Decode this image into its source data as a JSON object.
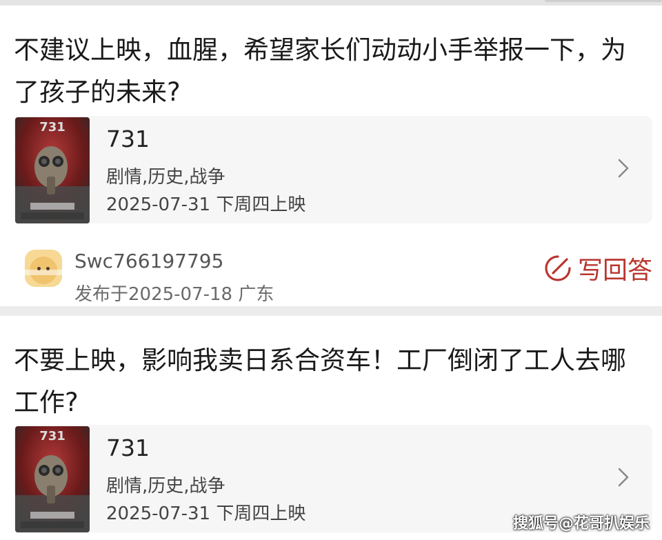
{
  "posts": [
    {
      "question": "不建议上映，血腥，希望家长们动动小手举报一下，为了孩子的未来?",
      "movie": {
        "title": "731",
        "genre": "剧情,历史,战争",
        "release": "2025-07-31 下周四上映",
        "poster_icon": "movie-poster-gasmask"
      },
      "author": {
        "username": "Swc766197795",
        "meta": "发布于2025-07-18  广东"
      },
      "answer_label": "写回答"
    },
    {
      "question": "不要上映，影响我卖日系合资车！工厂倒闭了工人去哪工作?",
      "movie": {
        "title": "731",
        "genre": "剧情,历史,战争",
        "release": "2025-07-31 下周四上映",
        "poster_icon": "movie-poster-gasmask"
      }
    }
  ],
  "watermark": "搜狐号@花哥扒娱乐",
  "colors": {
    "accent": "#b8362f",
    "card_bg": "#ffffff",
    "movie_box_bg": "#f6f6f6",
    "page_bg": "#ececec"
  }
}
